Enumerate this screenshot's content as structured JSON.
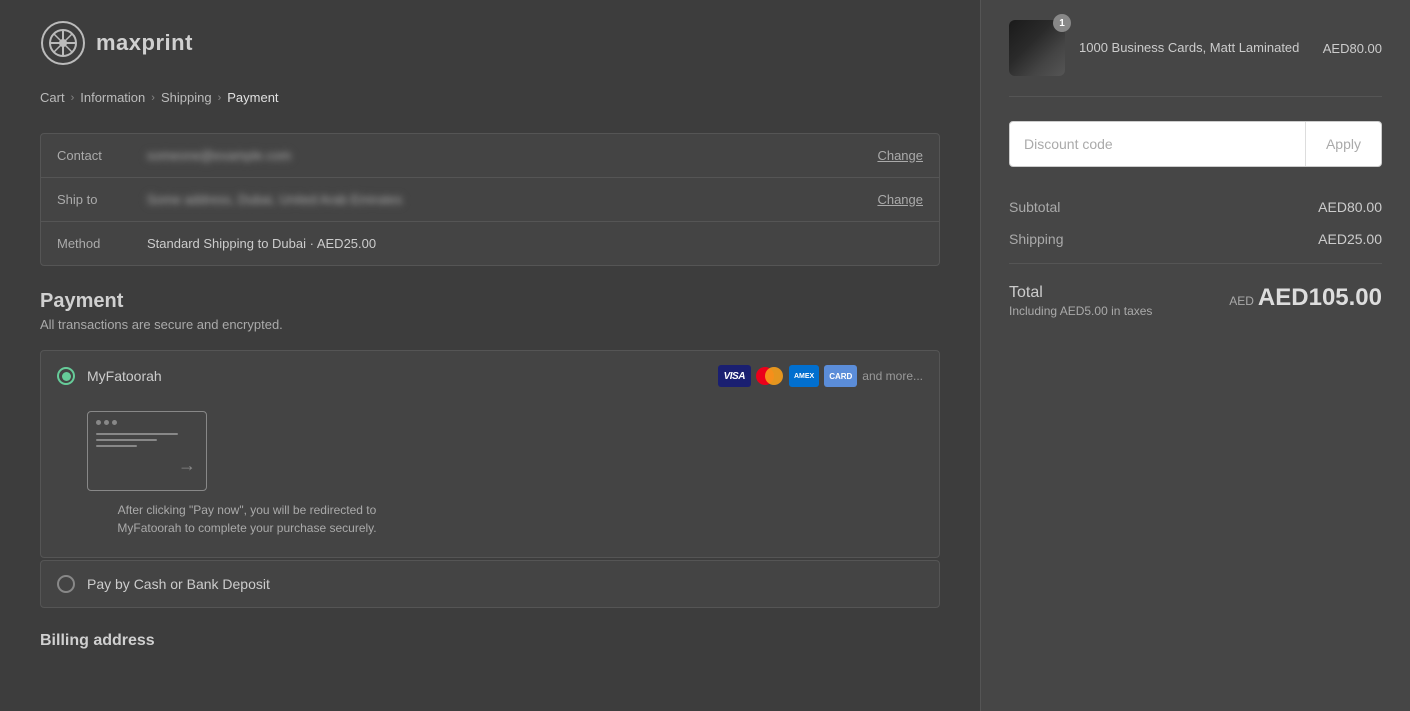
{
  "logo": {
    "text": "maxprint"
  },
  "breadcrumb": {
    "items": [
      "Cart",
      "Information",
      "Shipping",
      "Payment"
    ],
    "active": "Payment"
  },
  "order_info": {
    "contact_label": "Contact",
    "contact_value": "someone@example.com",
    "ship_to_label": "Ship to",
    "ship_to_value": "Some address, Dubai, United Arab Emirates",
    "method_label": "Method",
    "method_value": "Standard Shipping to Dubai · AED25.00",
    "change_label": "Change"
  },
  "payment": {
    "title": "Payment",
    "subtitle": "All transactions are secure and encrypted.",
    "options": [
      {
        "id": "myfatoorah",
        "label": "MyFatoorah",
        "selected": true,
        "icons": [
          "VISA",
          "MC",
          "AMEX",
          "CARD"
        ],
        "and_more": "and more...",
        "redirect_text": "After clicking \"Pay now\", you will be redirected to MyFatoorah to complete your purchase securely."
      },
      {
        "id": "cash",
        "label": "Pay by Cash or Bank Deposit",
        "selected": false
      }
    ]
  },
  "billing": {
    "title": "Billing address"
  },
  "right_panel": {
    "product": {
      "name": "1000 Business Cards, Matt Laminated",
      "price": "AED80.00",
      "quantity": "1"
    },
    "discount": {
      "placeholder": "Discount code",
      "apply_label": "Apply"
    },
    "subtotal_label": "Subtotal",
    "subtotal_value": "AED80.00",
    "shipping_label": "Shipping",
    "shipping_value": "AED25.00",
    "total_label": "Total",
    "total_tax_label": "Including AED5.00 in taxes",
    "total_currency": "AED",
    "total_amount": "AED105.00"
  }
}
